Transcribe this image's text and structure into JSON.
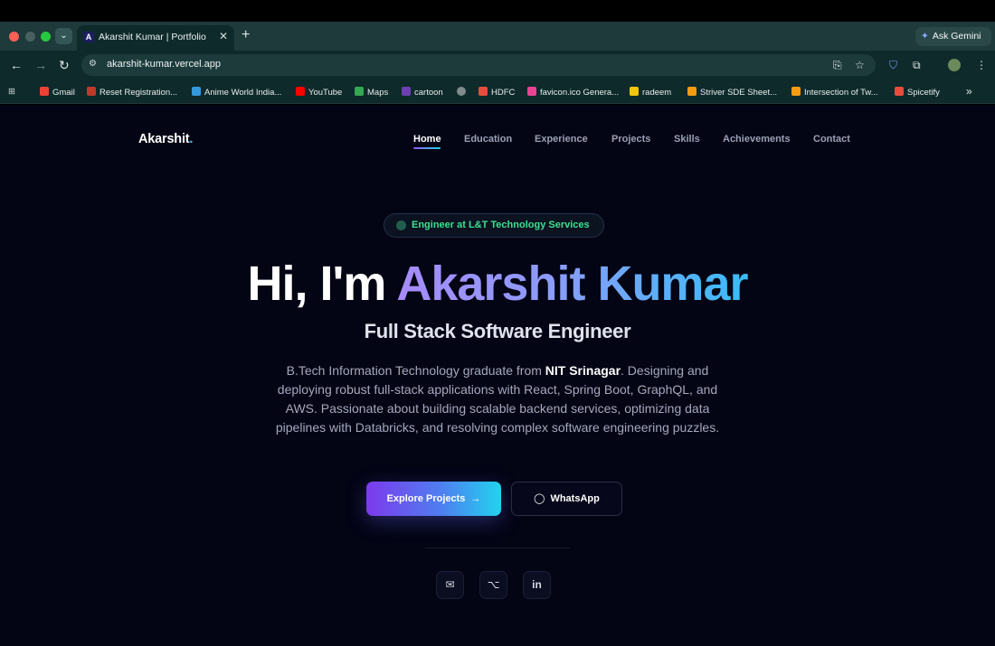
{
  "browser": {
    "tab_title": "Akarshit Kumar | Portfolio",
    "tab_favicon_letter": "A",
    "url": "akarshit-kumar.vercel.app",
    "gemini_label": "Ask Gemini",
    "bookmarks": [
      {
        "label": "Gmail",
        "color": "#ea4335"
      },
      {
        "label": "Reset Registration...",
        "color": "#c0392b"
      },
      {
        "label": "Anime World India...",
        "color": "#3498db"
      },
      {
        "label": "YouTube",
        "color": "#ff0000"
      },
      {
        "label": "Maps",
        "color": "#34a853"
      },
      {
        "label": "cartoon",
        "color": "#6c3fb5"
      },
      {
        "label": "",
        "color": "#7f8c8d"
      },
      {
        "label": "HDFC",
        "color": "#e74c3c"
      },
      {
        "label": "favicon.ico Genera...",
        "color": "#e84393"
      },
      {
        "label": "radeem",
        "color": "#f1c40f"
      },
      {
        "label": "Striver SDE Sheet...",
        "color": "#f39c12"
      },
      {
        "label": "Intersection of Tw...",
        "color": "#f39c12"
      },
      {
        "label": "Spicetify",
        "color": "#e74c3c"
      }
    ]
  },
  "site": {
    "logo": "Akarshit",
    "logo_dot": ".",
    "nav": [
      "Home",
      "Education",
      "Experience",
      "Projects",
      "Skills",
      "Achievements",
      "Contact"
    ],
    "badge": "Engineer at L&T Technology Services",
    "hero_prefix": "Hi, I'm ",
    "hero_name": "Akarshit Kumar",
    "subtitle": "Full Stack Software Engineer",
    "desc_before": "B.Tech Information Technology graduate from ",
    "desc_highlight": "NIT Srinagar",
    "desc_after": ". Designing and deploying robust full-stack applications with React, Spring Boot, GraphQL, and AWS. Passionate about building scalable backend services, optimizing data pipelines with Databricks, and resolving complex software engineering puzzles.",
    "primary_button": "Explore Projects",
    "primary_arrow": "→",
    "secondary_button": "WhatsApp",
    "secondary_icon": "◯",
    "social_icons": {
      "mail": "✉",
      "github": "⌥",
      "linkedin": "in"
    }
  }
}
